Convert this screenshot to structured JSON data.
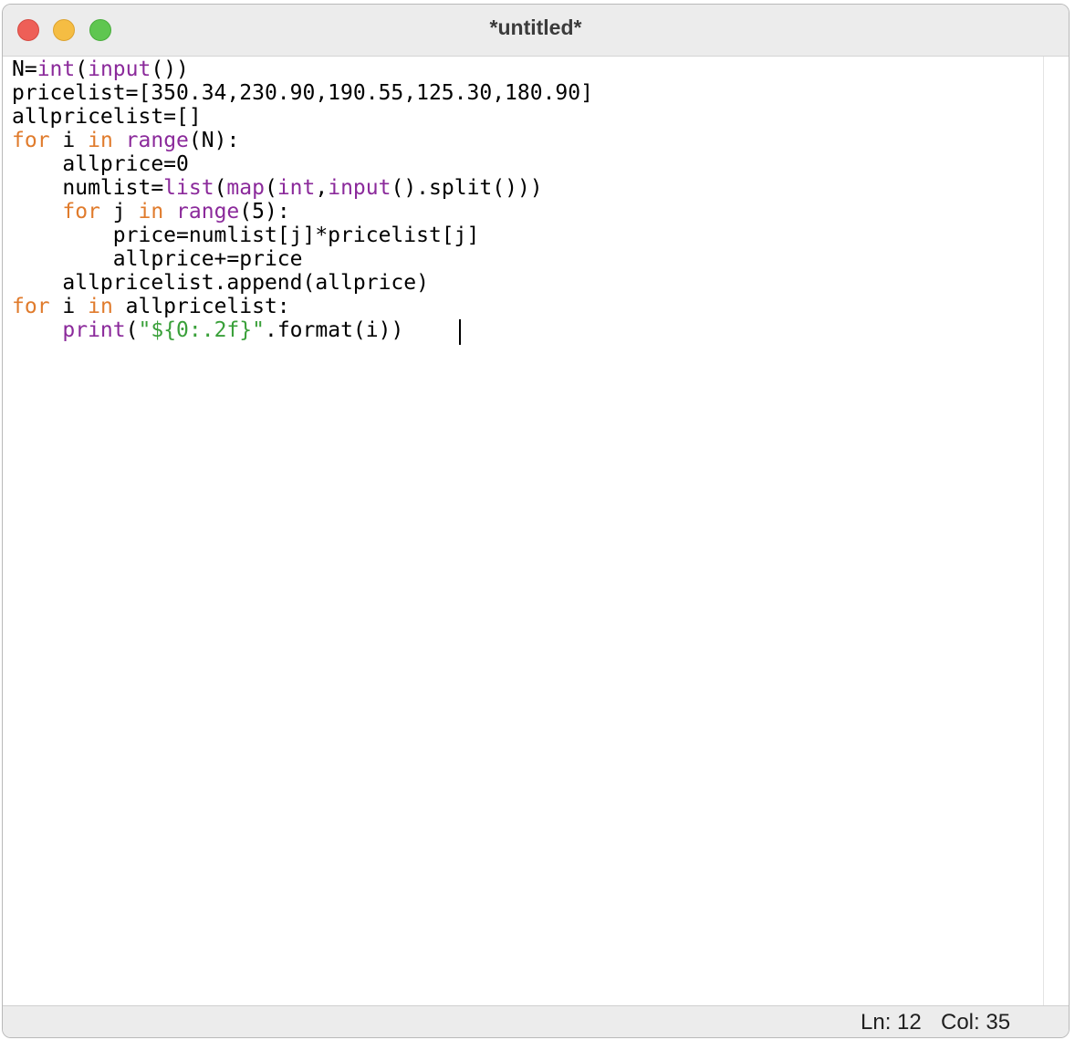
{
  "window": {
    "title": "*untitled*"
  },
  "editor": {
    "lines": [
      [
        {
          "t": "N="
        },
        {
          "t": "int",
          "c": "bi"
        },
        {
          "t": "("
        },
        {
          "t": "input",
          "c": "bi"
        },
        {
          "t": "())"
        }
      ],
      [
        {
          "t": "pricelist=[350.34,230.90,190.55,125.30,180.90]"
        }
      ],
      [
        {
          "t": "allpricelist=[]"
        }
      ],
      [
        {
          "t": "for",
          "c": "kw"
        },
        {
          "t": " i "
        },
        {
          "t": "in",
          "c": "kw"
        },
        {
          "t": " "
        },
        {
          "t": "range",
          "c": "bi"
        },
        {
          "t": "(N):"
        }
      ],
      [
        {
          "t": "    allprice=0"
        }
      ],
      [
        {
          "t": "    numlist="
        },
        {
          "t": "list",
          "c": "bi"
        },
        {
          "t": "("
        },
        {
          "t": "map",
          "c": "bi"
        },
        {
          "t": "("
        },
        {
          "t": "int",
          "c": "bi"
        },
        {
          "t": ","
        },
        {
          "t": "input",
          "c": "bi"
        },
        {
          "t": "().split()))"
        }
      ],
      [
        {
          "t": "    "
        },
        {
          "t": "for",
          "c": "kw"
        },
        {
          "t": " j "
        },
        {
          "t": "in",
          "c": "kw"
        },
        {
          "t": " "
        },
        {
          "t": "range",
          "c": "bi"
        },
        {
          "t": "(5):"
        }
      ],
      [
        {
          "t": "        price=numlist[j]*pricelist[j]"
        }
      ],
      [
        {
          "t": "        allprice+=price"
        }
      ],
      [
        {
          "t": "    allpricelist.append(allprice)"
        }
      ],
      [
        {
          "t": "for",
          "c": "kw"
        },
        {
          "t": " i "
        },
        {
          "t": "in",
          "c": "kw"
        },
        {
          "t": " allpricelist:"
        }
      ],
      [
        {
          "t": "    "
        },
        {
          "t": "print",
          "c": "bi"
        },
        {
          "t": "("
        },
        {
          "t": "\"${0:.2f}\"",
          "c": "str"
        },
        {
          "t": ".format(i))"
        }
      ]
    ]
  },
  "status": {
    "ln": "Ln: 12",
    "col": "Col: 35"
  },
  "colors": {
    "keyword": "#e07b2c",
    "builtin": "#8b2a9b",
    "string": "#3aa03a"
  }
}
